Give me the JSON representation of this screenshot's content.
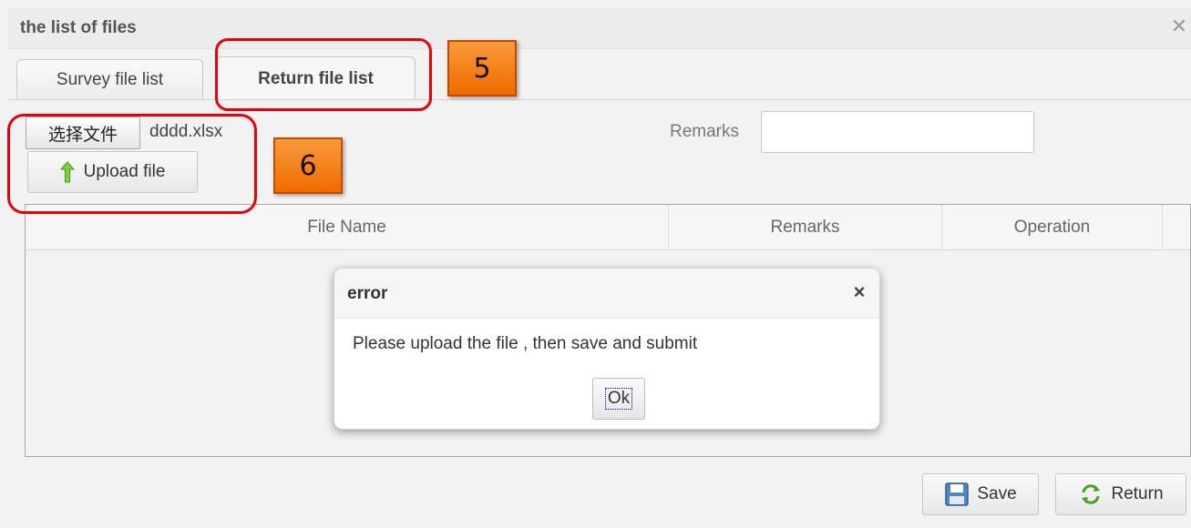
{
  "window": {
    "title": "the list of files",
    "close_glyph": "✕"
  },
  "tabs": [
    {
      "label": "Survey file list",
      "active": false
    },
    {
      "label": "Return file list",
      "active": true
    }
  ],
  "upload": {
    "choose_button_label": "选择文件",
    "selected_file": "dddd.xlsx",
    "upload_button_label": "Upload file",
    "upload_icon": "up-arrow-icon"
  },
  "remarks": {
    "label": "Remarks",
    "value": ""
  },
  "table": {
    "columns": [
      "File Name",
      "Remarks",
      "Operation"
    ],
    "rows": []
  },
  "footer": {
    "save_label": "Save",
    "save_icon": "floppy-disk-icon",
    "return_label": "Return",
    "return_icon": "refresh-arrows-icon"
  },
  "dialog": {
    "title": "error",
    "close_glyph": "×",
    "message": "Please upload the file , then save and submit",
    "ok_label": "Ok"
  },
  "annotations": [
    {
      "number": "5",
      "target": "Return file list tab"
    },
    {
      "number": "6",
      "target": "file chooser and upload button"
    }
  ],
  "colors": {
    "annotation_ring": "#e8000b",
    "annotation_badge": "#f27f1b",
    "up_arrow": "#5fbf2a"
  }
}
